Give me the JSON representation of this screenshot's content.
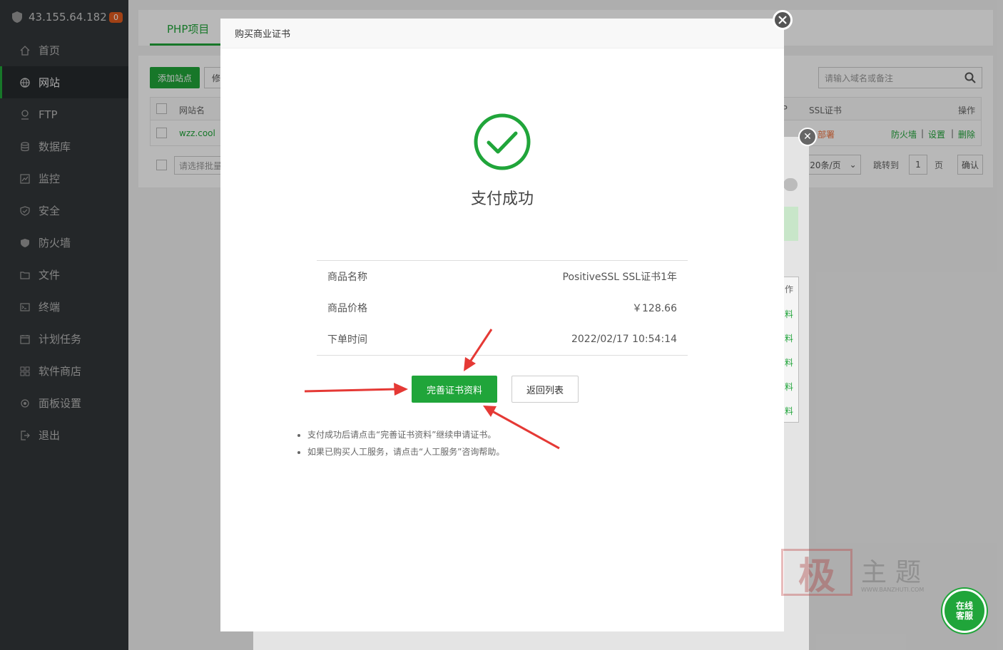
{
  "sidebar": {
    "ip": "43.155.64.182",
    "badge": "0",
    "items": [
      {
        "label": "首页",
        "icon": "home-icon"
      },
      {
        "label": "网站",
        "icon": "globe-icon"
      },
      {
        "label": "FTP",
        "icon": "ftp-icon"
      },
      {
        "label": "数据库",
        "icon": "database-icon"
      },
      {
        "label": "监控",
        "icon": "monitor-icon"
      },
      {
        "label": "安全",
        "icon": "shield-icon"
      },
      {
        "label": "防火墙",
        "icon": "firewall-icon"
      },
      {
        "label": "文件",
        "icon": "folder-icon"
      },
      {
        "label": "终端",
        "icon": "terminal-icon"
      },
      {
        "label": "计划任务",
        "icon": "calendar-icon"
      },
      {
        "label": "软件商店",
        "icon": "grid-icon"
      },
      {
        "label": "面板设置",
        "icon": "settings-icon"
      },
      {
        "label": "退出",
        "icon": "logout-icon"
      }
    ]
  },
  "background": {
    "tab": "PHP项目",
    "add_site": "添加站点",
    "modify": "修",
    "search_placeholder": "请输入域名或备注",
    "col_site": "网站名",
    "col_ip": "IP",
    "col_ssl": "SSL证书",
    "col_actions": "操作",
    "row_site": "wzz.cool",
    "row_ssl": "部署",
    "row_firewall": "防火墙",
    "row_settings": "设置",
    "row_delete": "删除",
    "sep": "|",
    "batch_placeholder": "请选择批量",
    "per_page": "20条/页",
    "jump_to": "跳转到",
    "page_num": "1",
    "page_unit": "页",
    "confirm": "确认",
    "side_label": "作",
    "side_links": [
      "料",
      "料",
      "料",
      "料",
      "料"
    ]
  },
  "modal": {
    "title": "购买商业证书",
    "success": "支付成功",
    "rows": [
      {
        "label": "商品名称",
        "value": "PositiveSSL SSL证书1年"
      },
      {
        "label": "商品价格",
        "value": "￥128.66"
      },
      {
        "label": "下单时间",
        "value": "2022/02/17 10:54:14"
      }
    ],
    "btn_complete": "完善证书资料",
    "btn_back": "返回列表",
    "notes": [
      "支付成功后请点击“完善证书资料”继续申请证书。",
      "如果已购买人工服务，请点击“人工服务”咨询帮助。"
    ]
  },
  "watermark": {
    "stamp": "极",
    "text": "主题",
    "url": "WWW.BANZHUTI.COM"
  },
  "chat": {
    "line1": "在线",
    "line2": "客服"
  },
  "colors": {
    "accent": "#20a53a",
    "sidebar_bg": "#323639",
    "arrow": "#e53935"
  }
}
